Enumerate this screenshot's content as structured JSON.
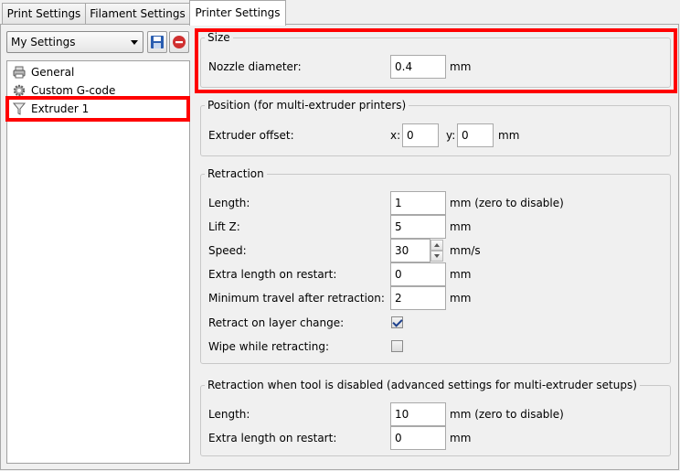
{
  "tabs": [
    {
      "label": "Print Settings"
    },
    {
      "label": "Filament Settings"
    },
    {
      "label": "Printer Settings"
    }
  ],
  "active_tab": "Printer Settings",
  "presets": {
    "selected": "My Settings"
  },
  "tree": [
    {
      "label": "General",
      "icon": "printer-icon"
    },
    {
      "label": "Custom G-code",
      "icon": "gear-icon"
    },
    {
      "label": "Extruder 1",
      "icon": "funnel-icon"
    }
  ],
  "size": {
    "title": "Size",
    "nozzle_label": "Nozzle diameter:",
    "nozzle_value": "0.4",
    "nozzle_unit": "mm"
  },
  "position": {
    "title": "Position (for multi-extruder printers)",
    "offset_label": "Extruder offset:",
    "x_label": "x:",
    "x_value": "0",
    "y_label": "y:",
    "y_value": "0",
    "unit": "mm"
  },
  "retraction": {
    "title": "Retraction",
    "length_label": "Length:",
    "length_value": "1",
    "length_unit": "mm (zero to disable)",
    "liftz_label": "Lift Z:",
    "liftz_value": "5",
    "liftz_unit": "mm",
    "speed_label": "Speed:",
    "speed_value": "30",
    "speed_unit": "mm/s",
    "extra_label": "Extra length on restart:",
    "extra_value": "0",
    "extra_unit": "mm",
    "mintravel_label": "Minimum travel after retraction:",
    "mintravel_value": "2",
    "mintravel_unit": "mm",
    "layer_change_label": "Retract on layer change:",
    "layer_change_checked": true,
    "wipe_label": "Wipe while retracting:",
    "wipe_checked": false
  },
  "retraction_disabled": {
    "title": "Retraction when tool is disabled (advanced settings for multi-extruder setups)",
    "length_label": "Length:",
    "length_value": "10",
    "length_unit": "mm (zero to disable)",
    "extra_label": "Extra length on restart:",
    "extra_value": "0",
    "extra_unit": "mm"
  },
  "colors": {
    "highlight": "#ff0000",
    "save_icon": "#2a5db0",
    "delete_icon": "#d03030"
  }
}
